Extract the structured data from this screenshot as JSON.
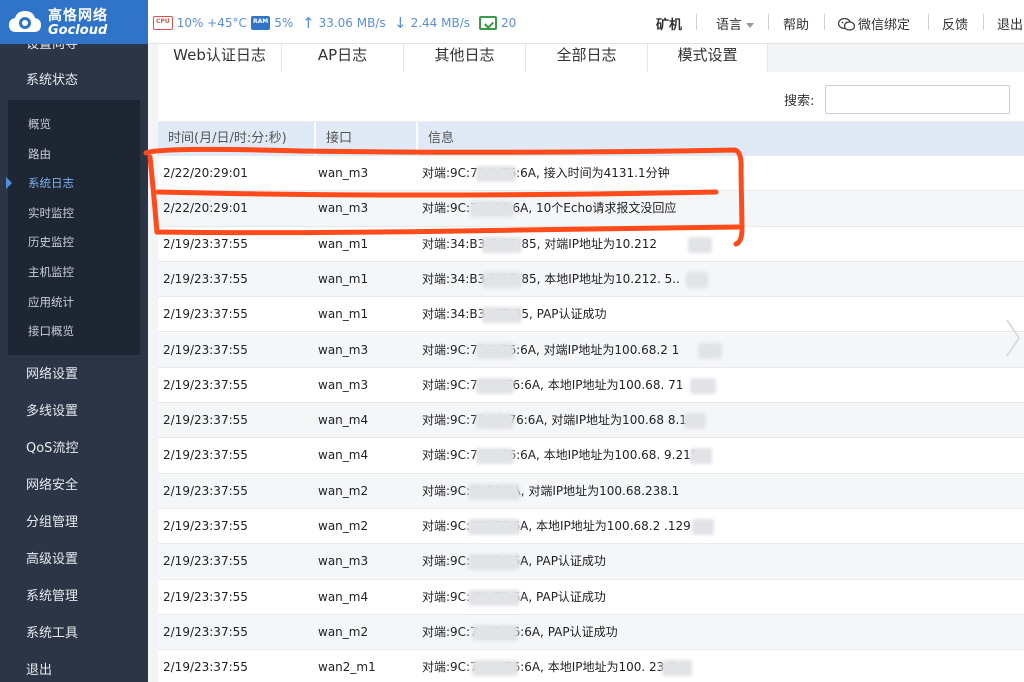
{
  "brand": {
    "name_cn": "高恪网络",
    "name_en": "Gocloud"
  },
  "stats": {
    "cpu": "10% +45°C",
    "ram": "5%",
    "upload": "33.06 MB/s",
    "download": "2.44 MB/s",
    "terminals": "20",
    "cpu_chip": "CPU",
    "ram_chip": "RAM"
  },
  "top_menu": {
    "miner": "矿机",
    "language": "语言",
    "help": "帮助",
    "wechat": "微信绑定",
    "feedback": "反馈",
    "logout": "退出"
  },
  "sidebar": {
    "items": [
      {
        "label": "设置向导"
      },
      {
        "label": "系统状态"
      },
      {
        "label": "网络设置"
      },
      {
        "label": "多线设置"
      },
      {
        "label": "QoS流控"
      },
      {
        "label": "网络安全"
      },
      {
        "label": "分组管理"
      },
      {
        "label": "高级设置"
      },
      {
        "label": "系统管理"
      },
      {
        "label": "系统工具"
      },
      {
        "label": "退出"
      }
    ],
    "submenu": [
      {
        "label": "概览"
      },
      {
        "label": "路由"
      },
      {
        "label": "系统日志"
      },
      {
        "label": "实时监控"
      },
      {
        "label": "历史监控"
      },
      {
        "label": "主机监控"
      },
      {
        "label": "应用统计"
      },
      {
        "label": "接口概览"
      }
    ],
    "active_submenu": "系统日志"
  },
  "tabs": [
    {
      "label": "Web认证日志"
    },
    {
      "label": "AP日志"
    },
    {
      "label": "其他日志"
    },
    {
      "label": "全部日志"
    },
    {
      "label": "模式设置"
    }
  ],
  "search": {
    "label": "搜索:",
    "value": "",
    "placeholder": ""
  },
  "table": {
    "columns": [
      "时间(月/日/时:分:秒)",
      "接口",
      "信息"
    ],
    "rows": [
      {
        "time": "2/22/20:29:01",
        "iface": "wan_m3",
        "info": "对端:9C:71      0:76:6A,  接入时间为4131.1分钟"
      },
      {
        "time": "2/22/20:29:01",
        "iface": "wan_m3",
        "info": "对端:9C:7       0:76:6A,  10个Echo请求报文没回应"
      },
      {
        "time": "2/19/23:37:55",
        "iface": "wan_m1",
        "info": "对端:34:B3      E:CB:85,  对端IP地址为10.212"
      },
      {
        "time": "2/19/23:37:55",
        "iface": "wan_m1",
        "info": "对端:34:B3      E:CB:85,  本地IP地址为10.212.      5.."
      },
      {
        "time": "2/19/23:37:55",
        "iface": "wan_m1",
        "info": "对端:34:B3      :CB:85,  PAP认证成功"
      },
      {
        "time": "2/19/23:37:55",
        "iface": "wan_m3",
        "info": "对端:9C:71      2:76:6A,  对端IP地址为100.68.2     1"
      },
      {
        "time": "2/19/23:37:55",
        "iface": "wan_m3",
        "info": "对端:9C:71:     2:76:6A,  本地IP地址为100.68.     71"
      },
      {
        "time": "2/19/23:37:55",
        "iface": "wan_m4",
        "info": "对端:9C:71      20:76:6A,  对端IP地址为100.68     8.1"
      },
      {
        "time": "2/19/23:37:55",
        "iface": "wan_m4",
        "info": "对端:9C:71      2:76:6A,  本地IP地址为100.68.     9.215"
      },
      {
        "time": "2/19/23:37:55",
        "iface": "wan_m2",
        "info": "对端:9C:        2:76:6A,  对端IP地址为100.68.238.1"
      },
      {
        "time": "2/19/23:37:55",
        "iface": "wan_m2",
        "info": "对端:9C:        20:76:6A,  本地IP地址为100.68.2     .129"
      },
      {
        "time": "2/19/23:37:55",
        "iface": "wan_m3",
        "info": "对端:9C:        20:76:6A,  PAP认证成功"
      },
      {
        "time": "2/19/23:37:55",
        "iface": "wan_m4",
        "info": "对端:9C:        20:76:6A,  PAP认证成功"
      },
      {
        "time": "2/19/23:37:55",
        "iface": "wan_m2",
        "info": "对端:9C:7       :20:76:6A,  PAP认证成功"
      },
      {
        "time": "2/19/23:37:55",
        "iface": "wan2_m1",
        "info": "对端:9C:7       :20:76:6A,  本地IP地址为100.      23     7"
      }
    ]
  },
  "colors": {
    "brand_blue": "#2f74c9",
    "sidebar_bg": "#2b3545",
    "annotation": "#ff4a1c"
  }
}
